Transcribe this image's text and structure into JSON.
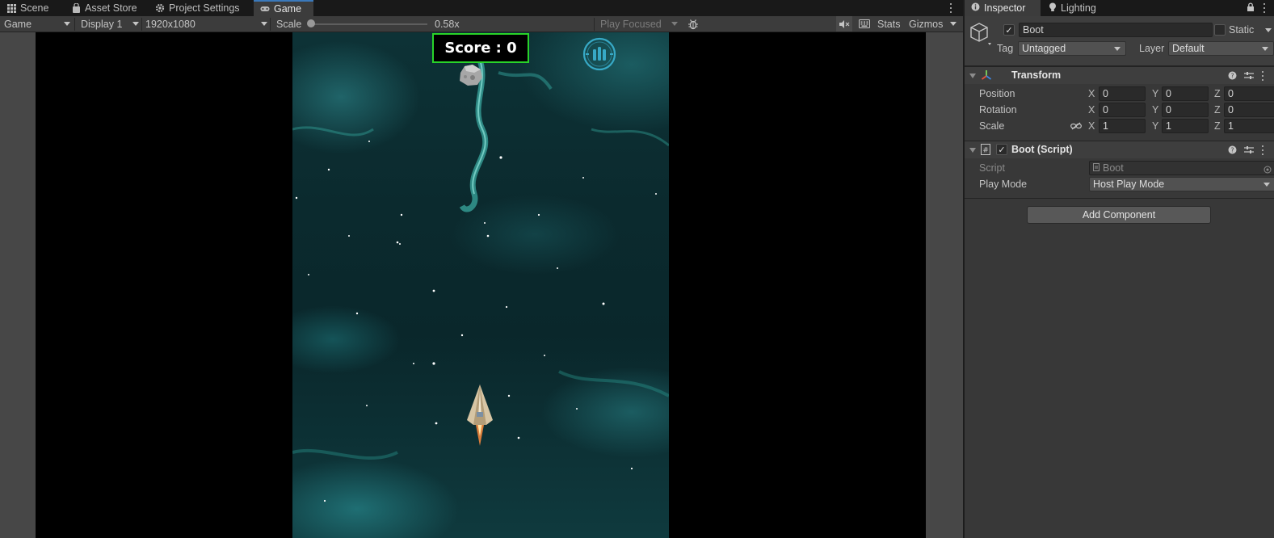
{
  "tabs": [
    {
      "label": "Scene",
      "icon": "grid-icon"
    },
    {
      "label": "Asset Store",
      "icon": "bag-icon"
    },
    {
      "label": "Project Settings",
      "icon": "gear-icon"
    },
    {
      "label": "Game",
      "icon": "gamepad-icon",
      "active": true
    }
  ],
  "toolbar": {
    "view_mode": "Game",
    "display": "Display 1",
    "resolution": "1920x1080",
    "scale_label": "Scale",
    "scale_value": "0.58x",
    "scale_fraction": 0.0,
    "play_mode": "Play Focused",
    "stats": "Stats",
    "gizmos": "Gizmos"
  },
  "game": {
    "score_text": "Score : 0"
  },
  "inspector_tabs": [
    {
      "label": "Inspector",
      "icon": "info-icon",
      "active": true
    },
    {
      "label": "Lighting",
      "icon": "bulb-icon"
    }
  ],
  "object": {
    "name": "Boot",
    "active": true,
    "static_label": "Static",
    "tag_label": "Tag",
    "tag_value": "Untagged",
    "layer_label": "Layer",
    "layer_value": "Default"
  },
  "transform": {
    "title": "Transform",
    "rows": [
      {
        "label": "Position",
        "x": "0",
        "y": "0",
        "z": "0"
      },
      {
        "label": "Rotation",
        "x": "0",
        "y": "0",
        "z": "0"
      },
      {
        "label": "Scale",
        "x": "1",
        "y": "1",
        "z": "1"
      }
    ],
    "axis_x": "X",
    "axis_y": "Y",
    "axis_z": "Z"
  },
  "boot_script": {
    "title": "Boot (Script)",
    "script_label": "Script",
    "script_value": "Boot",
    "play_mode_label": "Play Mode",
    "play_mode_value": "Host Play Mode"
  },
  "add_component": "Add Component",
  "colors": {
    "accent": "#3a79bb",
    "score_border": "#29d329",
    "panel_bg": "#383838",
    "toolbar_bg": "#3c3c3c"
  }
}
